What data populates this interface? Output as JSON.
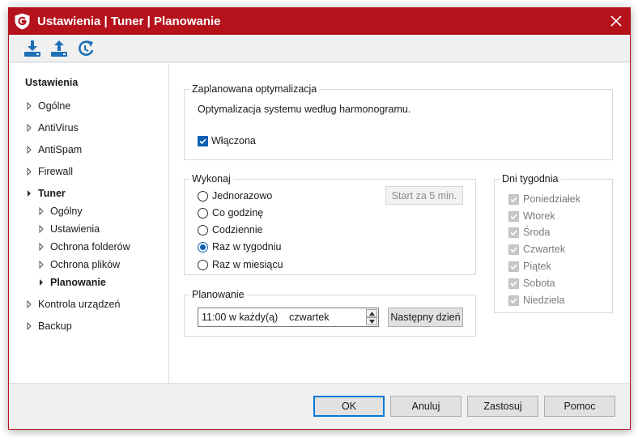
{
  "window": {
    "title": "Ustawienia | Tuner | Planowanie"
  },
  "toolbar": {
    "icons": [
      "import-icon",
      "export-icon",
      "reset-icon"
    ]
  },
  "sidebar": {
    "heading": "Ustawienia",
    "items": [
      {
        "label": "Ogólne"
      },
      {
        "label": "AntiVirus"
      },
      {
        "label": "AntiSpam"
      },
      {
        "label": "Firewall"
      },
      {
        "label": "Tuner"
      },
      {
        "label": "Ogólny"
      },
      {
        "label": "Ustawienia"
      },
      {
        "label": "Ochrona folderów"
      },
      {
        "label": "Ochrona plików"
      },
      {
        "label": "Planowanie"
      },
      {
        "label": "Kontrola urządzeń"
      },
      {
        "label": "Backup"
      }
    ]
  },
  "scheduled": {
    "legend": "Zaplanowana optymalizacja",
    "description": "Optymalizacja systemu według harmonogramu.",
    "enabled_label": "Włączona",
    "enabled": true
  },
  "execute": {
    "legend": "Wykonaj",
    "start_button": "Start za 5 min.",
    "options": [
      {
        "label": "Jednorazowo",
        "selected": false
      },
      {
        "label": "Co godzinę",
        "selected": false
      },
      {
        "label": "Codziennie",
        "selected": false
      },
      {
        "label": "Raz w tygodniu",
        "selected": true
      },
      {
        "label": "Raz w miesiącu",
        "selected": false
      }
    ]
  },
  "days": {
    "legend": "Dni tygodnia",
    "items": [
      "Poniedziałek",
      "Wtorek",
      "Środa",
      "Czwartek",
      "Piątek",
      "Sobota",
      "Niedziela"
    ]
  },
  "planning": {
    "legend": "Planowanie",
    "time_value": "11:00 w każdy(ą)    czwartek",
    "next_day_button": "Następny dzień"
  },
  "footer": {
    "ok": "OK",
    "cancel": "Anuluj",
    "apply": "Zastosuj",
    "help": "Pomoc"
  },
  "colors": {
    "accent": "#b5121b",
    "check_blue": "#0b5fb0",
    "toolbar_blue": "#1e6fb8"
  }
}
